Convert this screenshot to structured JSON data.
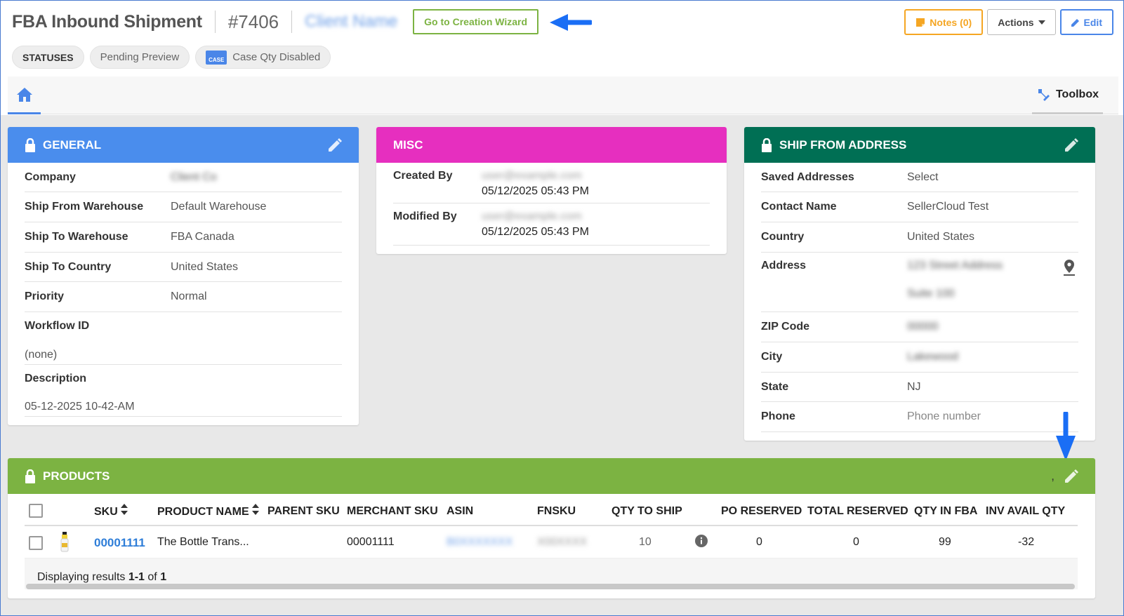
{
  "header": {
    "title": "FBA Inbound Shipment",
    "order_number": "#7406",
    "client_name": "Client Name",
    "wizard_button": "Go to Creation Wizard",
    "notes_button": "Notes (0)",
    "actions_button": "Actions",
    "edit_button": "Edit"
  },
  "statuses": {
    "label": "STATUSES",
    "items": [
      "Pending Preview",
      "Case Qty Disabled"
    ],
    "case_icon_text": "CASE"
  },
  "tabs": {
    "toolbox": "Toolbox"
  },
  "general": {
    "title": "GENERAL",
    "rows": [
      {
        "label": "Company",
        "value": "Client Co"
      },
      {
        "label": "Ship From Warehouse",
        "value": "Default Warehouse"
      },
      {
        "label": "Ship To Warehouse",
        "value": "FBA Canada"
      },
      {
        "label": "Ship To Country",
        "value": "United States"
      },
      {
        "label": "Priority",
        "value": "Normal"
      },
      {
        "label": "Workflow ID",
        "value": "(none)"
      },
      {
        "label": "Description",
        "value": "05-12-2025 10-42-AM"
      }
    ]
  },
  "misc": {
    "title": "MISC",
    "rows": [
      {
        "label": "Created By",
        "user": "user@example.com",
        "date": "05/12/2025 05:43 PM"
      },
      {
        "label": "Modified By",
        "user": "user@example.com",
        "date": "05/12/2025 05:43 PM"
      }
    ]
  },
  "ship_from": {
    "title": "SHIP FROM ADDRESS",
    "rows": [
      {
        "label": "Saved Addresses",
        "value": "Select"
      },
      {
        "label": "Contact Name",
        "value": "SellerCloud Test"
      },
      {
        "label": "Country",
        "value": "United States"
      },
      {
        "label": "Address",
        "value": "123 Street Address",
        "value2": "Suite 100"
      },
      {
        "label": "ZIP Code",
        "value": "00000"
      },
      {
        "label": "City",
        "value": "Lakewood"
      },
      {
        "label": "State",
        "value": "NJ"
      },
      {
        "label": "Phone",
        "value": "Phone number"
      }
    ]
  },
  "products": {
    "title": "PRODUCTS",
    "comma": ",",
    "columns": [
      "SKU",
      "PRODUCT NAME",
      "PARENT SKU",
      "MERCHANT SKU",
      "ASIN",
      "FNSKU",
      "QTY TO SHIP",
      "PO RESERVED",
      "TOTAL RESERVED",
      "QTY IN FBA",
      "INV AVAIL QTY"
    ],
    "row": {
      "sku": "00001111",
      "product_name": "The Bottle Trans...",
      "parent_sku": "",
      "merchant_sku": "00001111",
      "asin": "B0XXXXXXX",
      "fnsku": "X00XXXX",
      "qty_to_ship": "10",
      "po_reserved": "0",
      "total_reserved": "0",
      "qty_in_fba": "99",
      "inv_avail_qty": "-32"
    },
    "footer": {
      "prefix": "Displaying results ",
      "range": "1-1",
      "of": " of ",
      "total": "1"
    }
  },
  "colors": {
    "general": "#4a8ded",
    "misc": "#e62fbf",
    "ship_from": "#006f54",
    "products": "#7cb342",
    "arrow": "#1a6ef5"
  }
}
